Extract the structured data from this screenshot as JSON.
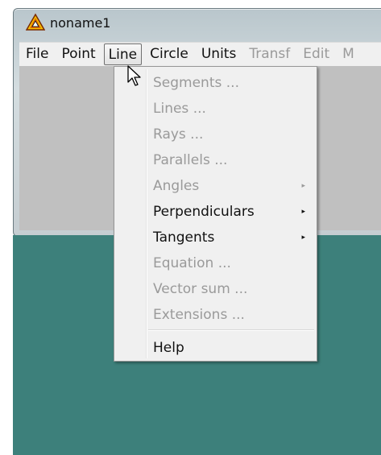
{
  "window": {
    "title": "noname1",
    "icon": "triangle-app-icon"
  },
  "menubar": {
    "items": [
      {
        "label": "File",
        "disabled": false
      },
      {
        "label": "Point",
        "disabled": false
      },
      {
        "label": "Line",
        "disabled": false,
        "active": true
      },
      {
        "label": "Circle",
        "disabled": false
      },
      {
        "label": "Units",
        "disabled": false
      },
      {
        "label": "Transf",
        "disabled": true
      },
      {
        "label": "Edit",
        "disabled": true
      },
      {
        "label": "M",
        "disabled": true
      }
    ]
  },
  "line_menu": {
    "items": [
      {
        "label": "Segments ...",
        "enabled": false,
        "submenu": false
      },
      {
        "label": "Lines ...",
        "enabled": false,
        "submenu": false
      },
      {
        "label": "Rays ...",
        "enabled": false,
        "submenu": false
      },
      {
        "label": "Parallels ...",
        "enabled": false,
        "submenu": false
      },
      {
        "label": "Angles",
        "enabled": false,
        "submenu": true
      },
      {
        "label": "Perpendiculars",
        "enabled": true,
        "submenu": true
      },
      {
        "label": "Tangents",
        "enabled": true,
        "submenu": true
      },
      {
        "label": "Equation ...",
        "enabled": false,
        "submenu": false
      },
      {
        "label": "Vector sum ...",
        "enabled": false,
        "submenu": false
      },
      {
        "label": "Extensions ...",
        "enabled": false,
        "submenu": false
      },
      {
        "label": "Help",
        "enabled": true,
        "submenu": false
      }
    ],
    "submenu_arrow": "▸"
  },
  "colors": {
    "client_area": "#c0c0c0",
    "desktop_teal": "#3d807b",
    "menu_bg": "#f0f0f0",
    "disabled_text": "#9a9a9a"
  }
}
